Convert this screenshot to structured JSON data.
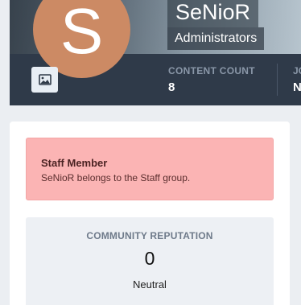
{
  "profile": {
    "avatar_letter": "S",
    "avatar_color": "#cc8a64",
    "username": "SeNioR",
    "group": "Administrators",
    "cover_photo_icon": "image-icon"
  },
  "stats": [
    {
      "label": "CONTENT COUNT",
      "value": "8"
    },
    {
      "label": "JOI",
      "value": "No"
    }
  ],
  "staff": {
    "title": "Staff Member",
    "description": "SeNioR belongs to the Staff group.",
    "bg_color": "#fbb4b4"
  },
  "reputation": {
    "title": "COMMUNITY REPUTATION",
    "value": "0",
    "status": "Neutral"
  }
}
